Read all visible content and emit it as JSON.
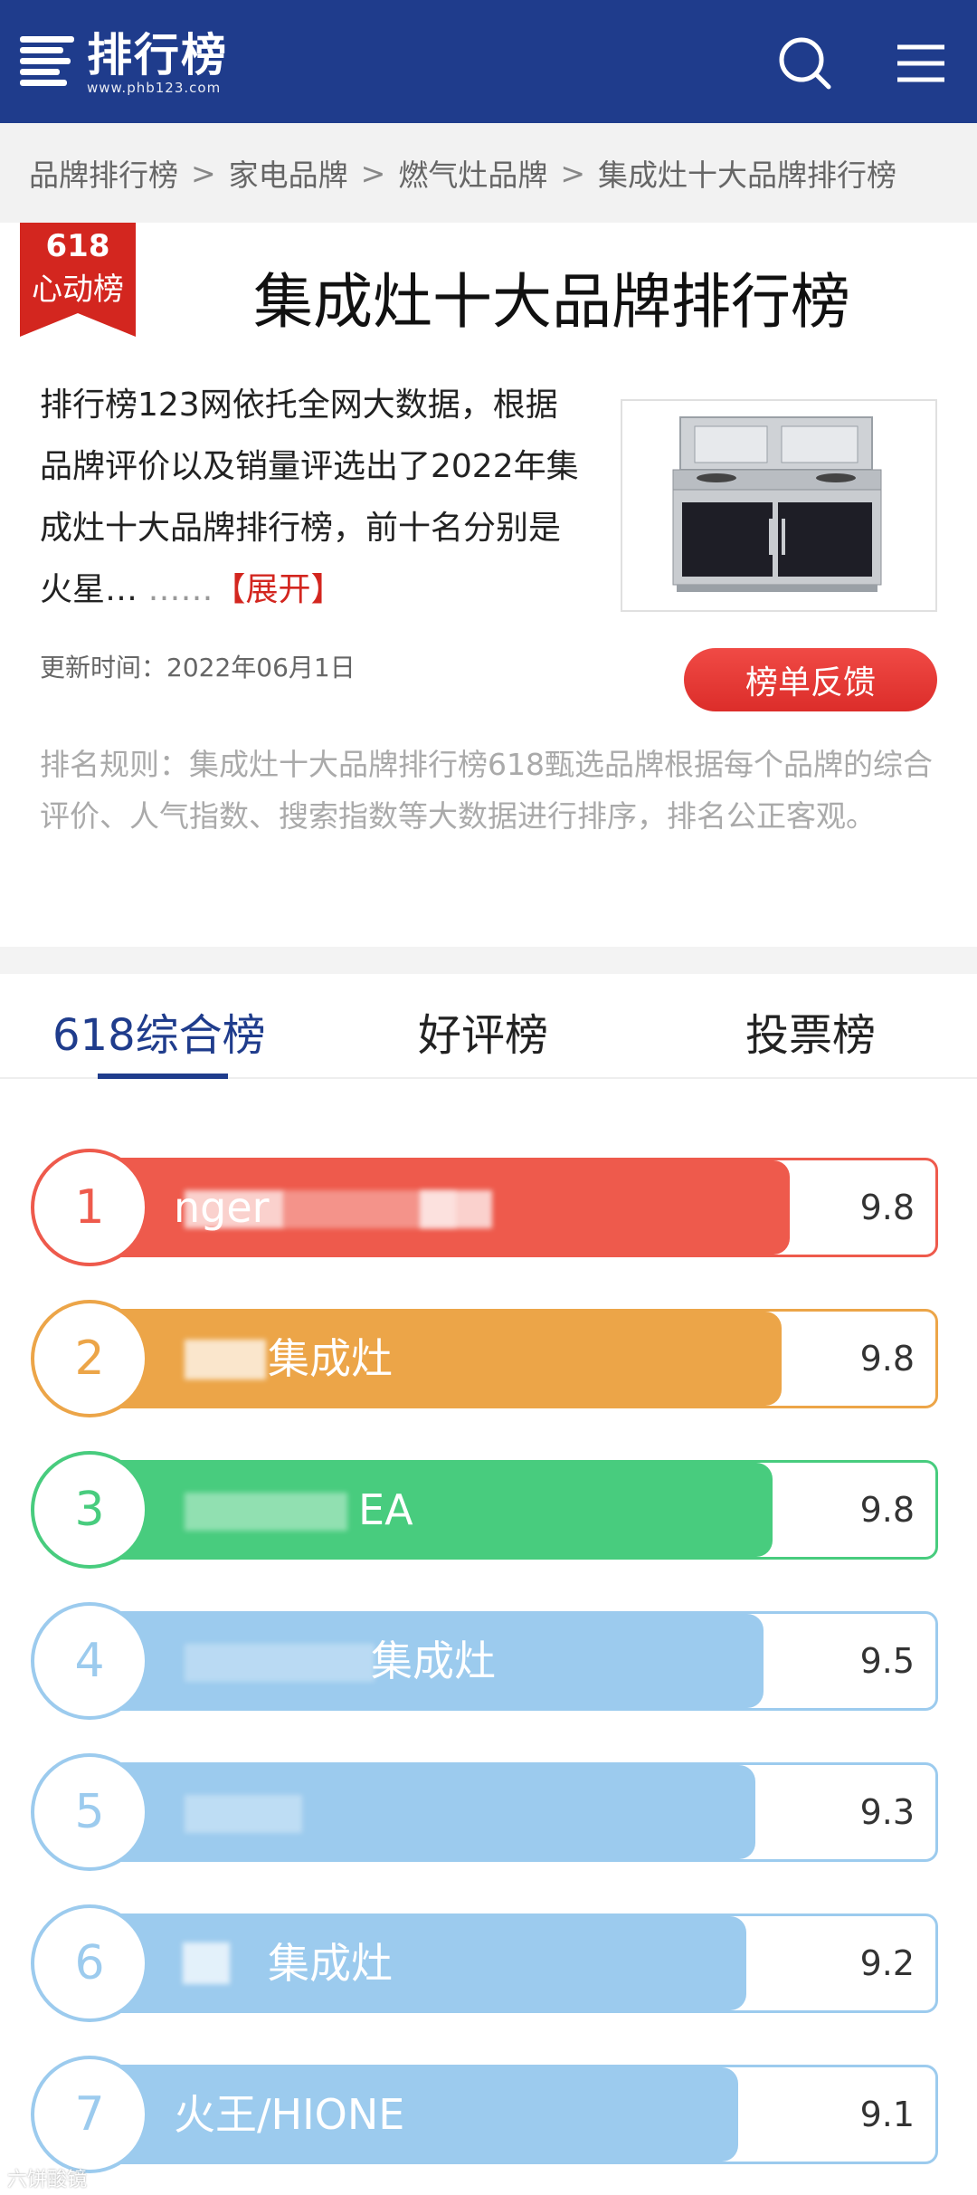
{
  "header": {
    "logo_title": "排行榜",
    "logo_url": "www.phb123.com",
    "search_icon": "search-icon",
    "menu_icon": "menu-icon",
    "brand_color": "#1f3c8c"
  },
  "breadcrumb": [
    "品牌排行榜",
    "家电品牌",
    "燃气灶品牌",
    "集成灶十大品牌排行榜"
  ],
  "breadcrumb_separator": ">",
  "badge": {
    "number": "618",
    "text": "心动榜"
  },
  "page_title": "集成灶十大品牌排行榜",
  "intro": {
    "text": "排行榜123网依托全网大数据，根据品牌评价以及销量评选出了2022年集成灶十大品牌排行榜，前十名分别是火星…",
    "more": "……",
    "expand": "【展开】"
  },
  "updated": "更新时间：2022年06月1日",
  "feedback_button": "榜单反馈",
  "rule_text": "排名规则：集成灶十大品牌排行榜618甄选品牌根据每个品牌的综合评价、人气指数、搜索指数等大数据进行排序，排名公正客观。",
  "tabs": [
    {
      "label": "618综合榜",
      "active": true
    },
    {
      "label": "好评榜",
      "active": false
    },
    {
      "label": "投票榜",
      "active": false
    }
  ],
  "ranking": [
    {
      "rank": "1",
      "name": "nger",
      "score": "9.8",
      "color": "#ee5a4c",
      "fill": 0.83
    },
    {
      "rank": "2",
      "name": "集成灶",
      "score": "9.8",
      "color": "#eca548",
      "fill": 0.82
    },
    {
      "rank": "3",
      "name": "EA",
      "score": "9.8",
      "color": "#48cc7e",
      "fill": 0.81
    },
    {
      "rank": "4",
      "name": "集成灶",
      "score": "9.5",
      "color": "#9ccbee",
      "fill": 0.8
    },
    {
      "rank": "5",
      "name": "",
      "score": "9.3",
      "color": "#9ccbee",
      "fill": 0.79
    },
    {
      "rank": "6",
      "name": "集成灶",
      "score": "9.2",
      "color": "#9ccbee",
      "fill": 0.78
    },
    {
      "rank": "7",
      "name": "火王/HIONE",
      "score": "9.1",
      "color": "#9ccbee",
      "fill": 0.77
    }
  ],
  "watermark": "六饼酸镜"
}
